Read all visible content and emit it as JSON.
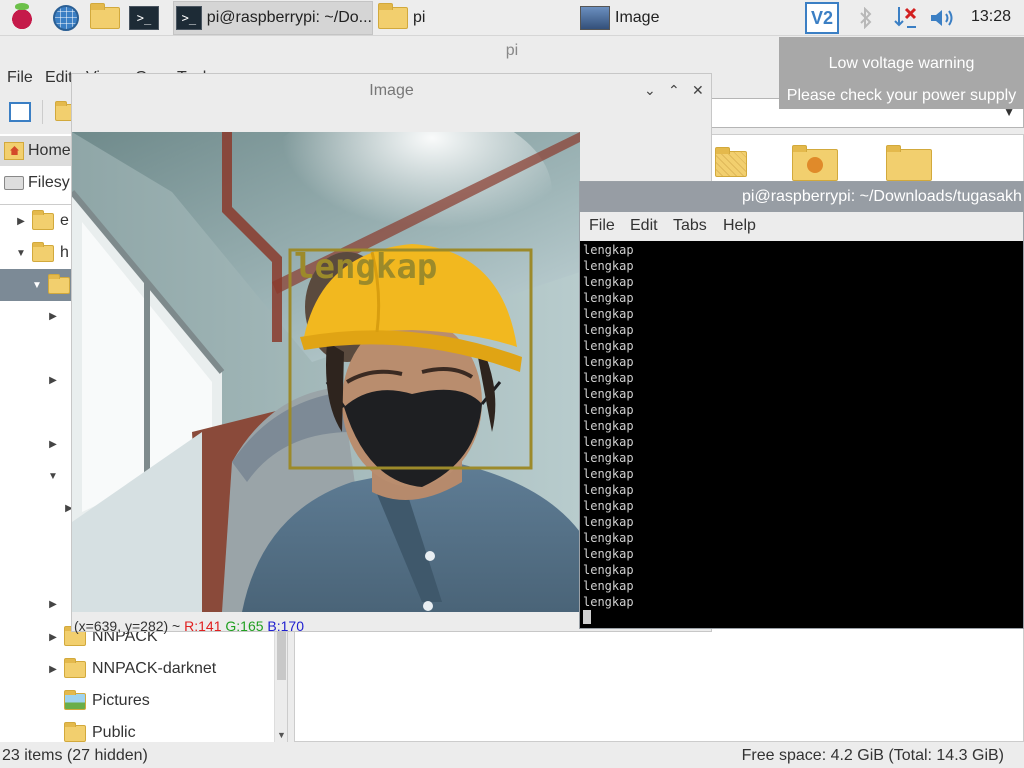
{
  "taskbar": {
    "launchers": [
      "raspberry-menu",
      "web-browser",
      "file-manager",
      "terminal"
    ],
    "tasks": [
      {
        "label": "pi@raspberrypi: ~/Do...",
        "icon": "terminal-icon",
        "active": true
      },
      {
        "label": "pi",
        "icon": "folder-icon",
        "active": false
      },
      {
        "label": "Image",
        "icon": "image-app-icon",
        "active": false
      }
    ],
    "tray": {
      "vnc_label": "V2",
      "clock": "13:28"
    }
  },
  "notification": {
    "title": "Low voltage warning",
    "body": "Please check your power supply"
  },
  "file_manager": {
    "title": "pi",
    "menu": [
      "File",
      "Edit",
      "View",
      "Go",
      "Tools"
    ],
    "places": [
      "Home",
      "Filesy"
    ],
    "tree": [
      {
        "label": "e",
        "expander": "collapsed"
      },
      {
        "label": "h",
        "expander": "expanded"
      },
      {
        "label": "",
        "expander": "expanded",
        "selected": true,
        "icon": "home-icon"
      },
      {
        "label": "NNPACK",
        "expander": "collapsed"
      },
      {
        "label": "NNPACK-darknet",
        "expander": "collapsed"
      },
      {
        "label": "Pictures",
        "expander": "none",
        "icon": "pictures-icon"
      },
      {
        "label": "Public",
        "expander": "none",
        "icon": "public-icon"
      }
    ],
    "status_left": "23 items (27 hidden)",
    "status_right": "Free space: 4.2 GiB (Total: 14.3 GiB)"
  },
  "image_viewer": {
    "title": "Image",
    "detection_label": "lengkap",
    "status": {
      "coords": "(x=639, y=282) ~",
      "r": "R:141",
      "g": "G:165",
      "b": "B:170",
      "r_color": "#e02020",
      "g_color": "#20a020",
      "b_color": "#2020d0"
    }
  },
  "terminal": {
    "title": "pi@raspberrypi: ~/Downloads/tugasakhir",
    "menu": [
      "File",
      "Edit",
      "Tabs",
      "Help"
    ],
    "lines": [
      "lengkap",
      "lengkap",
      "lengkap",
      "lengkap",
      "lengkap",
      "lengkap",
      "lengkap",
      "lengkap",
      "lengkap",
      "lengkap",
      "lengkap",
      "lengkap",
      "lengkap",
      "lengkap",
      "lengkap",
      "lengkap",
      "lengkap",
      "lengkap",
      "lengkap",
      "lengkap",
      "lengkap",
      "lengkap",
      "lengkap"
    ]
  },
  "colors": {
    "accent": "#3b7fc4",
    "tree_selection": "#7c8a96",
    "terminal_bg": "#000000",
    "detection_box": "#9c8a2a"
  }
}
